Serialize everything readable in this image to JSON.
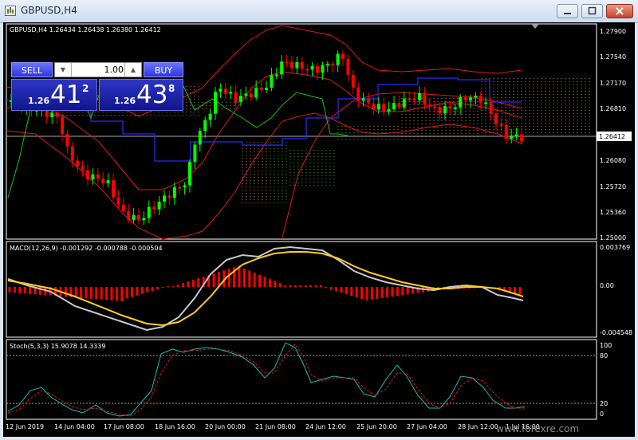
{
  "window": {
    "title": "GBPUSD,H4",
    "buttons": [
      "minimize",
      "maximize",
      "close"
    ]
  },
  "main_chart": {
    "info": "GBPUSD,H4  1.26434 1.26438 1.26380 1.26412",
    "price_axis": [
      "1.27900",
      "1.27540",
      "1.27170",
      "1.26810",
      "1.26080",
      "1.25720",
      "1.25360",
      "1.25000"
    ],
    "current_price": "1.26412"
  },
  "trade_panel": {
    "sell_label": "SELL",
    "buy_label": "BUY",
    "lot_size": "1.00",
    "sell_prefix": "1.26",
    "sell_big": "41",
    "sell_small": "2",
    "buy_prefix": "1.26",
    "buy_big": "43",
    "buy_small": "8"
  },
  "macd": {
    "label": "MACD(12,26,9) -0.001292 -0.000788 -0.000504",
    "axis": [
      "0.003769",
      "0.00",
      "-0.004548"
    ]
  },
  "stoch": {
    "label": "Stoch(5,3,3) 15.9078 14.3339",
    "axis": [
      "100",
      "80",
      "20",
      "0"
    ]
  },
  "time_axis": [
    "12 Jun 2019",
    "14 Jun 04:00",
    "17 Jun 08:00",
    "18 Jun 16:00",
    "20 Jun 00:00",
    "21 Jun 08:00",
    "24 Jun 12:00",
    "25 Jun 20:00",
    "27 Jun 04:00",
    "28 Jun 12:00",
    "1 Jul 16:00"
  ],
  "watermark": "www.forexre.com",
  "colors": {
    "bull": "#00ff00",
    "bear": "#ff0000",
    "background": "#000000",
    "trade_button": "#3b43e6"
  }
}
